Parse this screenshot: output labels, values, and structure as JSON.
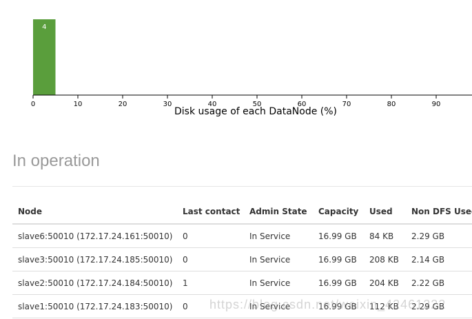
{
  "chart_data": {
    "type": "bar",
    "xlabel": "Disk usage of each DataNode (%)",
    "ylabel": "",
    "xlim": [
      0,
      98
    ],
    "xticks": [
      "0",
      "10",
      "20",
      "30",
      "40",
      "50",
      "60",
      "70",
      "80",
      "90"
    ],
    "bars": [
      {
        "x_start": 0,
        "x_end": 5,
        "count": 4,
        "label": "4"
      }
    ],
    "bar_color": "#5a9e3c",
    "grid": false
  },
  "section": {
    "title": "In operation"
  },
  "table": {
    "headers": [
      "Node",
      "Last contact",
      "Admin State",
      "Capacity",
      "Used",
      "Non DFS Used"
    ],
    "rows": [
      [
        "slave6:50010 (172.17.24.161:50010)",
        "0",
        "In Service",
        "16.99 GB",
        "84 KB",
        "2.29 GB"
      ],
      [
        "slave3:50010 (172.17.24.185:50010)",
        "0",
        "In Service",
        "16.99 GB",
        "208 KB",
        "2.14 GB"
      ],
      [
        "slave2:50010 (172.17.24.184:50010)",
        "1",
        "In Service",
        "16.99 GB",
        "204 KB",
        "2.22 GB"
      ],
      [
        "slave1:50010 (172.17.24.183:50010)",
        "0",
        "In Service",
        "16.99 GB",
        "112 KB",
        "2.29 GB"
      ]
    ]
  },
  "watermark": "https://blog.csdn.net/weixin_42461222"
}
